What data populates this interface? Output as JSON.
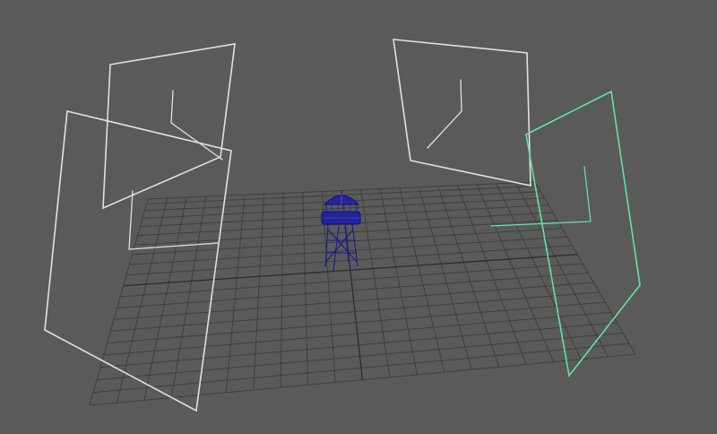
{
  "viewport": {
    "background_color": "#5a5a5a",
    "grid": {
      "visible": true,
      "divisions": 20,
      "line_color": "#3f3f3f",
      "axis_color": "#2f2f2f"
    }
  },
  "scene": {
    "object": {
      "name_icon": "watchtower-wireframe",
      "wire_color": "#1f1f8f"
    },
    "cameras": [
      {
        "id": "camera-1",
        "color": "#e0e0e0",
        "selected": false
      },
      {
        "id": "camera-2",
        "color": "#e0e0e0",
        "selected": false
      },
      {
        "id": "camera-3",
        "color": "#e0e0e0",
        "selected": false
      },
      {
        "id": "camera-4",
        "color": "#5fe3a1",
        "selected": true
      }
    ]
  }
}
